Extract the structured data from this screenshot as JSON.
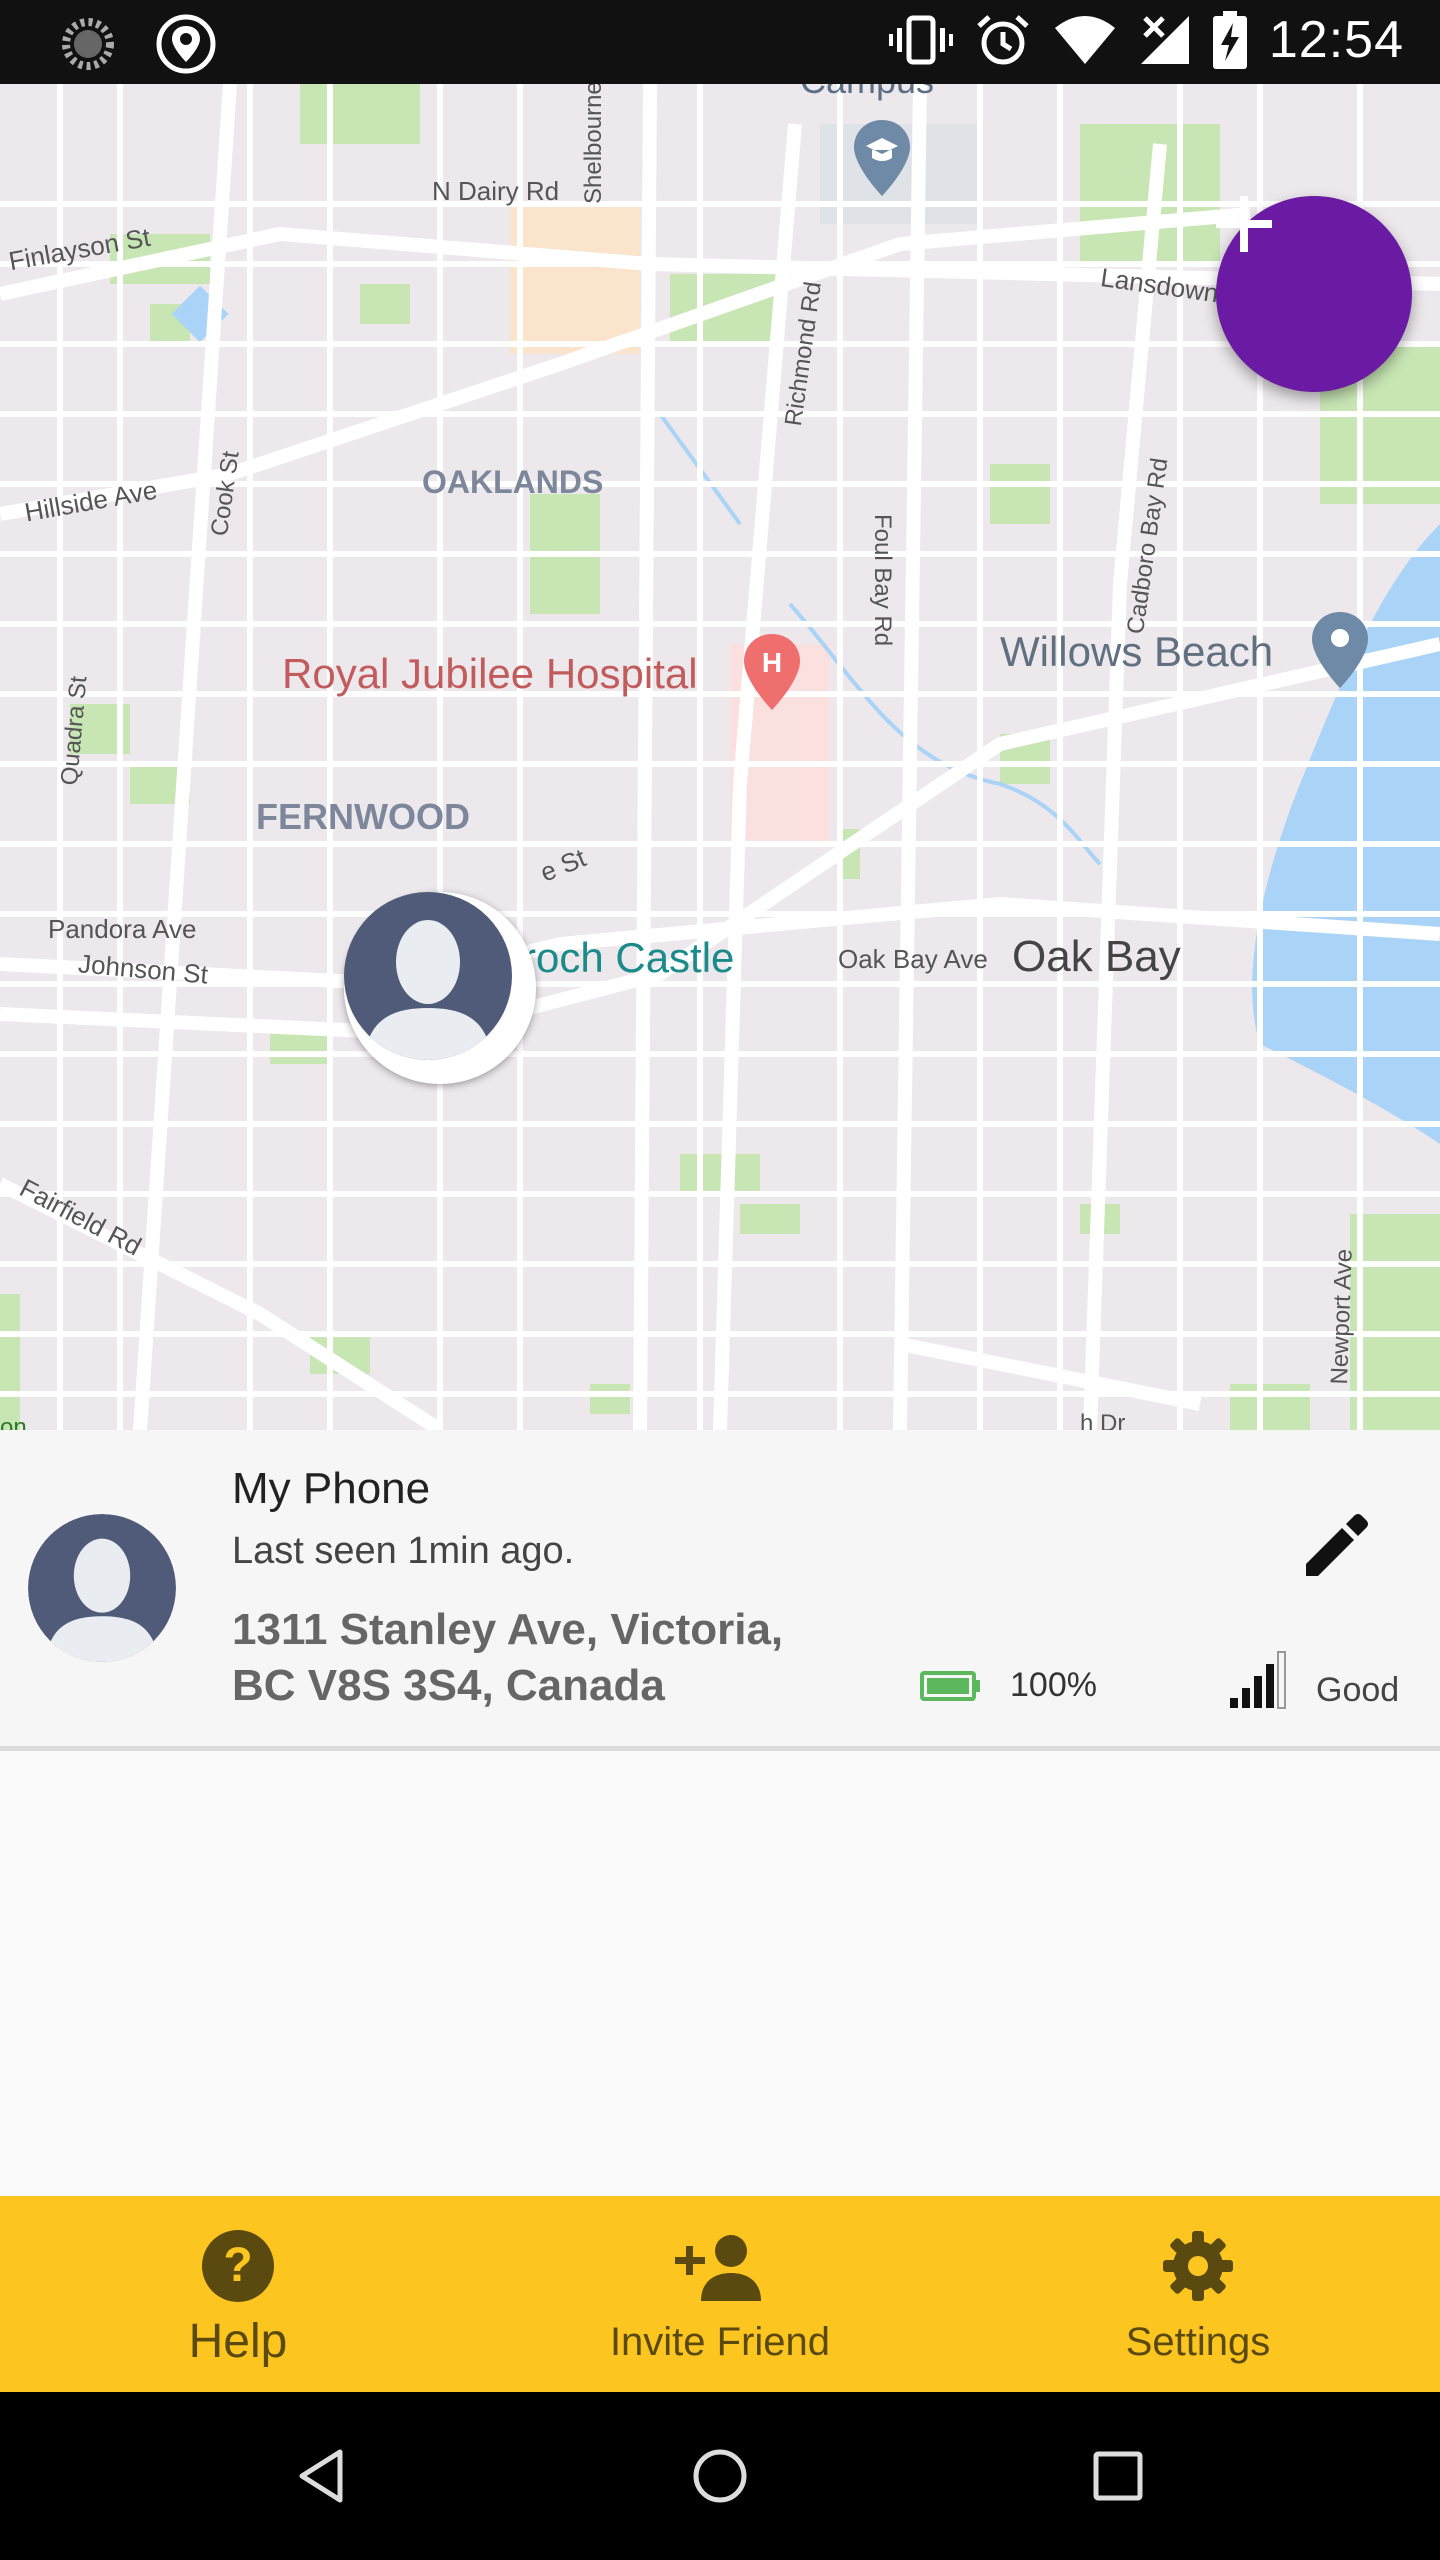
{
  "status_bar": {
    "time": "12:54",
    "icons": [
      "loading-icon",
      "location-pin-icon",
      "vibrate-icon",
      "alarm-icon",
      "wifi-icon",
      "no-signal-icon",
      "battery-charging-icon"
    ]
  },
  "map": {
    "labels": {
      "campus": "Campus",
      "n_dairy": "N Dairy Rd",
      "finlayson": "Finlayson St",
      "shelbourne": "Shelbourne St",
      "richmond": "Richmond Rd",
      "lansdowne": "Lansdowne Rd",
      "foul_bay": "Foul Bay Rd",
      "oaklands": "OAKLANDS",
      "hillside": "Hillside Ave",
      "cook": "Cook St",
      "cadboro": "Cadboro Bay Rd",
      "hospital": "Royal Jubilee Hospital",
      "willows": "Willows Beach",
      "quadra": "Quadra St",
      "fernwood": "FERNWOOD",
      "st_partial": "e St",
      "pandora": "Pandora Ave",
      "johnson": "Johnson St",
      "castle": "rroch Castle",
      "oak_bay_ave": "Oak Bay Ave",
      "oak_bay": "Oak Bay",
      "fairfield": "Fairfield Rd",
      "newport": "Newport Ave",
      "dr_partial": "h Dr",
      "edge_partial": "on"
    },
    "icons": [
      "school-pin-icon",
      "hospital-pin-icon",
      "beach-pin-icon",
      "museum-pin-icon"
    ],
    "colors": {
      "land": "#ece8ec",
      "road": "#ffffff",
      "park": "#c8e6b4",
      "water": "#aad3f8",
      "fab": "#6b1aa3"
    }
  },
  "fab": {
    "icon": "plus-icon"
  },
  "device": {
    "name": "My Phone",
    "last_seen": "Last seen 1min ago.",
    "address_line1": "1311 Stanley Ave, Victoria,",
    "address_line2": "BC V8S 3S4, Canada",
    "battery": "100%",
    "battery_level": 1.0,
    "signal": "Good"
  },
  "bottom_nav": {
    "help": "Help",
    "invite": "Invite Friend",
    "settings": "Settings",
    "bg_color": "#fdc51f"
  },
  "system_nav": [
    "back-icon",
    "home-icon",
    "recents-icon"
  ]
}
